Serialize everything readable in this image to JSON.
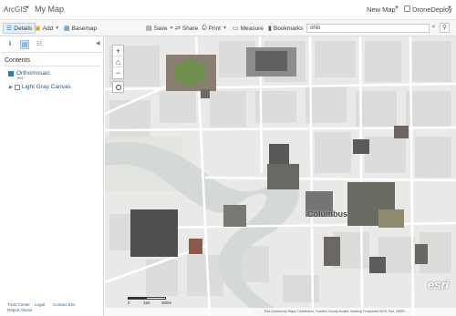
{
  "header": {
    "brand": "ArcGIS",
    "map_title": "My Map",
    "new_map": "New Map",
    "user_name": "DroneDeploy"
  },
  "toolbar": {
    "details": "Details",
    "add": "Add",
    "basemap": "Basemap",
    "save": "Save",
    "share": "Share",
    "print": "Print",
    "measure": "Measure",
    "bookmarks": "Bookmarks",
    "search_value": "ohio"
  },
  "sidebar": {
    "contents_heading": "Contents",
    "layers": [
      {
        "label": "Orthomosaic",
        "checked": true
      },
      {
        "label": "Light Gray Canvas",
        "checked": false
      }
    ],
    "footer_links": [
      "Trust Center",
      "Legal",
      "Contact Esri",
      "Report Abuse"
    ]
  },
  "map": {
    "zoom_in": "+",
    "zoom_out": "−",
    "city_label": "Columbus",
    "scale_labels": [
      "0",
      "150",
      "300m"
    ],
    "esri_logo": "esri",
    "attribution": "Esri Community Maps Contributors, Franklin County Auditor, Building Footprints/USGS, Esri, HERE..."
  },
  "colors": {
    "accent": "#2e7bb8",
    "map_background": "#e9e9e7",
    "river": "#d4d8d6",
    "street": "#ffffff"
  },
  "icons": {
    "details": "list-icon",
    "add": "plus-folder-icon",
    "basemap": "grid-icon",
    "save": "save-icon",
    "share": "share-icon",
    "print": "print-icon",
    "measure": "ruler-icon",
    "bookmarks": "bookmark-icon",
    "search": "search-icon",
    "locate": "locate-icon"
  }
}
